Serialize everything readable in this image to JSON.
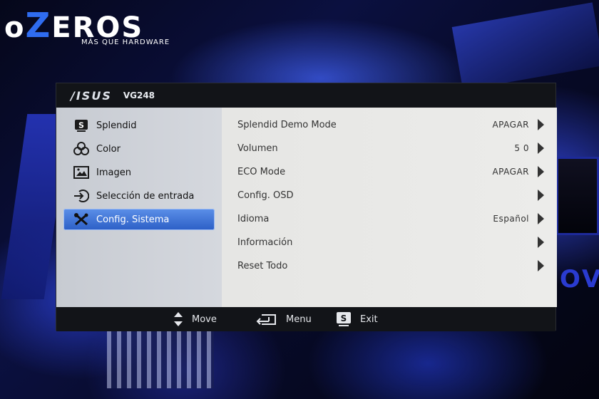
{
  "watermark": {
    "brand_prefix": "o",
    "brand_z": "Z",
    "brand_suffix": "EROS",
    "tagline": "MÁS QUE HARDWARE"
  },
  "background_text": "OVI",
  "osd": {
    "brand": "/ISUS",
    "model": "VG248",
    "sidebar": {
      "items": [
        {
          "label": "Splendid",
          "icon": "splendid-icon",
          "active": false
        },
        {
          "label": "Color",
          "icon": "color-icon",
          "active": false
        },
        {
          "label": "Imagen",
          "icon": "image-icon",
          "active": false
        },
        {
          "label": "Selección de entrada",
          "icon": "input-select-icon",
          "active": false
        },
        {
          "label": "Config. Sistema",
          "icon": "tools-icon",
          "active": true
        }
      ]
    },
    "settings": [
      {
        "label": "Splendid Demo Mode",
        "value": "APAGAR"
      },
      {
        "label": "Volumen",
        "value": "5 0"
      },
      {
        "label": "ECO Mode",
        "value": "APAGAR"
      },
      {
        "label": "Config. OSD",
        "value": ""
      },
      {
        "label": "Idioma",
        "value": "Español"
      },
      {
        "label": "Información",
        "value": ""
      },
      {
        "label": "Reset Todo",
        "value": ""
      }
    ],
    "footer": {
      "move_label": "Move",
      "menu_label": "Menu",
      "exit_label": "Exit"
    }
  },
  "colors": {
    "active_item": "#2c5fc6",
    "sidebar_bg": "#c7cbd2",
    "main_bg": "#e6e6e4",
    "bar_bg": "#121418",
    "logo_accent": "#2f6cf0"
  }
}
